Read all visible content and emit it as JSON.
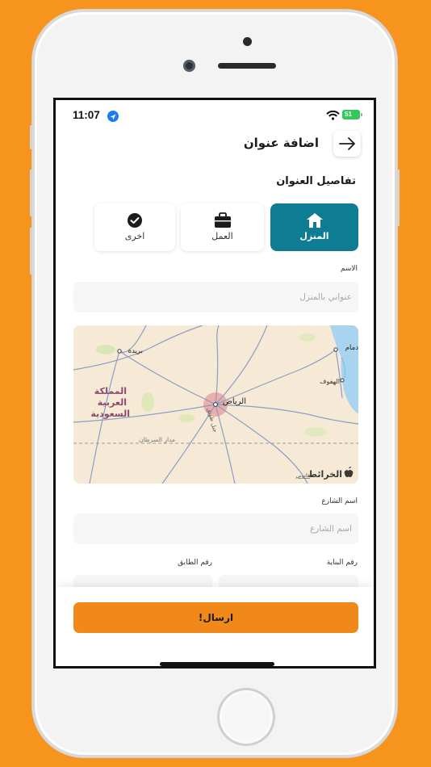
{
  "status_bar": {
    "time": "11:07",
    "battery": "51"
  },
  "header": {
    "title": "اضافة عنوان",
    "back_icon": "arrow-right-icon"
  },
  "section_title": "تفاصيل العنوان",
  "address_types": [
    {
      "label": "المنزل",
      "icon": "home-icon",
      "selected": true
    },
    {
      "label": "العمل",
      "icon": "briefcase-icon",
      "selected": false
    },
    {
      "label": "اخرى",
      "icon": "check-circle-icon",
      "selected": false
    }
  ],
  "form": {
    "name_label": "الاسم",
    "name_placeholder": "عنواني بالمنزل",
    "street_label": "اسم الشارع",
    "street_placeholder": "اسم الشارع",
    "building_label": "رقم البناية",
    "floor_label": "رقم الطابق"
  },
  "map": {
    "labels": {
      "riyadh": "الرياض",
      "buraidah": "بريدة",
      "dammam": "دمام",
      "hofuf": "الهفوف",
      "country_line1": "المملكة",
      "country_line2": "العربية",
      "country_line3": "السعودية",
      "tropic": "مدار السرطان",
      "tuwaiq": "جبل طويق",
      "brand": "الخرائط",
      "legal": "قانوني"
    }
  },
  "submit_label": "ارسال!",
  "colors": {
    "accent": "#0e7d93",
    "primary_button": "#f0891a",
    "background": "#F7941D"
  }
}
